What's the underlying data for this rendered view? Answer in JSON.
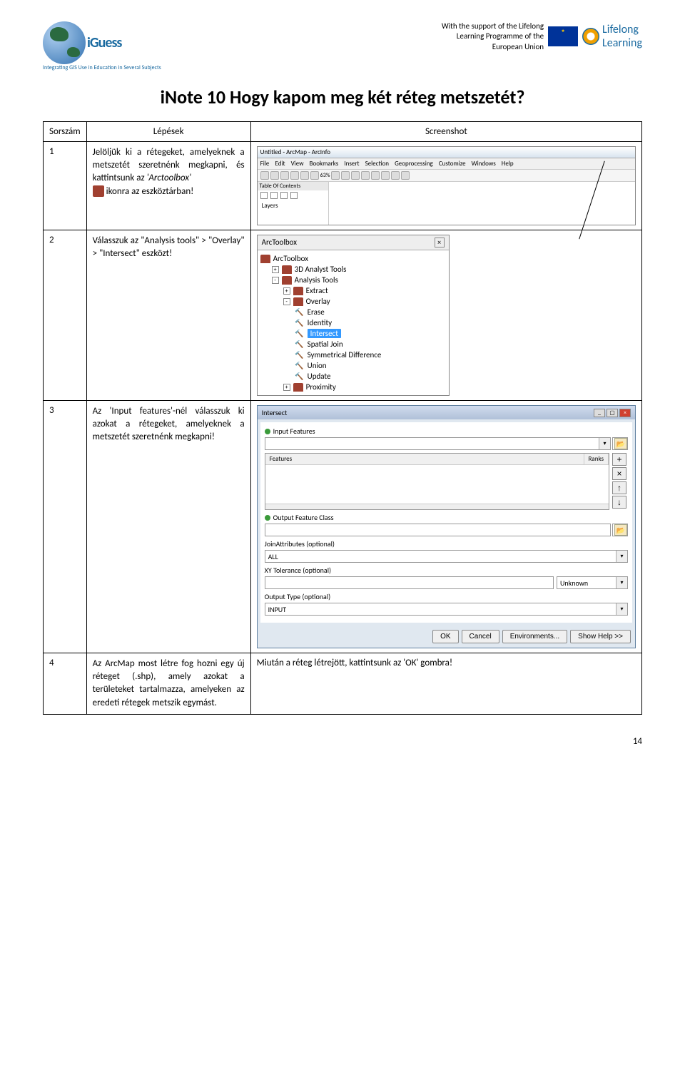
{
  "header": {
    "iguess_brand": "iGuess",
    "iguess_sub": "Integrating GIS Use in Education in Several Subjects",
    "support_line1": "With the support of the Lifelong",
    "support_line2": "Learning Programme of the",
    "support_line3": "European Union",
    "lifelong_l1": "Lifelong",
    "lifelong_l2": "Learning"
  },
  "title": "iNote 10    Hogy kapom meg két réteg metszetét?",
  "table_head": {
    "c1": "Sorszám",
    "c2": "Lépések",
    "c3": "Screenshot"
  },
  "steps": [
    {
      "num": "1",
      "text_a": "Jelöljük ki a rétegeket, amelyeknek a metszetét szeretnénk megkapni, és kattintsunk az ",
      "text_b": "'Arctoolbox'",
      "text_c": " ikonra az eszköztárban!"
    },
    {
      "num": "2",
      "text": "Válasszuk az \"Analysis tools\" > \"Overlay\" > \"Intersect\" eszközt!"
    },
    {
      "num": "3",
      "text": "Az 'Input features'-nél válasszuk ki azokat a rétegeket, amelyeknek a metszetét szeretnénk megkapni!"
    },
    {
      "num": "4",
      "text": "Az ArcMap most létre fog hozni egy új réteget (.shp), amely azokat a területeket tartalmazza, amelyeken az eredeti rétegek metszik egymást.",
      "result": "Miután a réteg létrejött, kattintsunk az 'OK' gombra!"
    }
  ],
  "ss1": {
    "win_title": "Untitled - ArcMap - ArcInfo",
    "menu": [
      "File",
      "Edit",
      "View",
      "Bookmarks",
      "Insert",
      "Selection",
      "Geoprocessing",
      "Customize",
      "Windows",
      "Help"
    ],
    "toc_title": "Table Of Contents",
    "layers": "Layers",
    "zoom": "63%"
  },
  "ss2": {
    "title": "ArcToolbox",
    "items": [
      {
        "lvl": 0,
        "kind": "tbx",
        "label": "ArcToolbox"
      },
      {
        "lvl": 1,
        "kind": "tbx",
        "label": "3D Analyst Tools",
        "exp": "+"
      },
      {
        "lvl": 1,
        "kind": "tbx",
        "label": "Analysis Tools",
        "exp": "-"
      },
      {
        "lvl": 2,
        "kind": "tbx",
        "label": "Extract",
        "exp": "+"
      },
      {
        "lvl": 2,
        "kind": "tbx",
        "label": "Overlay",
        "exp": "-"
      },
      {
        "lvl": 3,
        "kind": "tool",
        "label": "Erase"
      },
      {
        "lvl": 3,
        "kind": "tool",
        "label": "Identity"
      },
      {
        "lvl": 3,
        "kind": "tool",
        "label": "Intersect",
        "sel": true
      },
      {
        "lvl": 3,
        "kind": "tool",
        "label": "Spatial Join"
      },
      {
        "lvl": 3,
        "kind": "tool",
        "label": "Symmetrical Difference"
      },
      {
        "lvl": 3,
        "kind": "tool",
        "label": "Union"
      },
      {
        "lvl": 3,
        "kind": "tool",
        "label": "Update"
      },
      {
        "lvl": 2,
        "kind": "tbx",
        "label": "Proximity",
        "exp": "+"
      }
    ]
  },
  "ss3": {
    "title": "Intersect",
    "input_features": "Input Features",
    "features_col": "Features",
    "ranks_col": "Ranks",
    "output_class": "Output Feature Class",
    "join_attr": "JoinAttributes (optional)",
    "join_val": "ALL",
    "xy_tol": "XY Tolerance (optional)",
    "xy_unit": "Unknown",
    "out_type": "Output Type (optional)",
    "out_val": "INPUT",
    "btns": {
      "ok": "OK",
      "cancel": "Cancel",
      "env": "Environments...",
      "help": "Show Help >>"
    },
    "side_btns": [
      "+",
      "×",
      "↑",
      "↓"
    ]
  },
  "page_number": "14"
}
